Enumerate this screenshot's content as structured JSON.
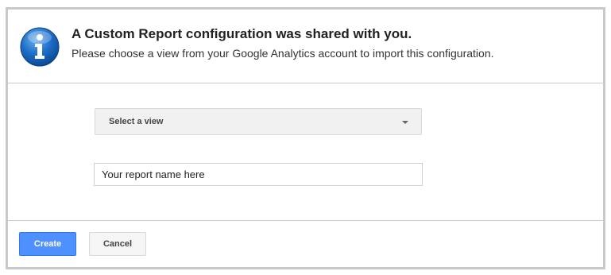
{
  "dialog": {
    "title": "A Custom Report configuration was shared with you.",
    "subtitle": "Please choose a view from your Google Analytics account to import this configuration.",
    "icon": "info-icon",
    "colors": {
      "accent": "#4d90fe",
      "icon_blue": "#1f6fc9"
    }
  },
  "form": {
    "view_select_label": "Select a view",
    "report_name_value": "Your report name here"
  },
  "footer": {
    "create_label": "Create",
    "cancel_label": "Cancel"
  }
}
